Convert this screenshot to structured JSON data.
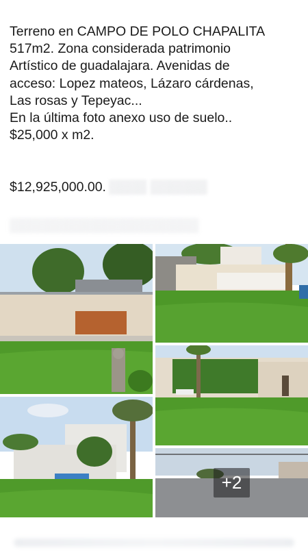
{
  "post": {
    "text": "Terreno en CAMPO DE POLO CHAPALITA\n517m2. Zona considerada patrimonio\nArtístico de guadalajara.  Avenidas de\nacceso: Lopez mateos, Lázaro cárdenas,\nLas rosas y  Tepeyac...\n En la última foto anexo uso de suelo..\n$25,000 x m2.",
    "price": "$12,925,000.00."
  },
  "photos": {
    "more_count_label": "+2"
  },
  "colors": {
    "lawn": "#4f9a2a",
    "sky": "#cfe2f3",
    "wall": "#e2d6c4"
  }
}
